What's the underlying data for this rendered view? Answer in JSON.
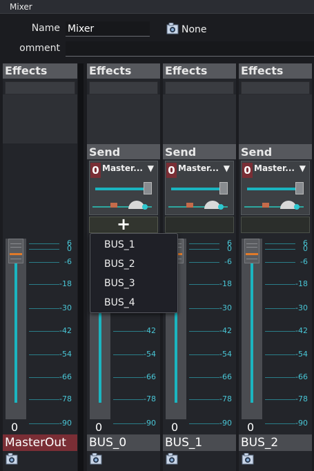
{
  "window": {
    "title": "Mixer"
  },
  "properties": {
    "name_label": "Name",
    "name_value": "Mixer",
    "comment_label": "omment",
    "comment_value": "",
    "preset_icon": "camera-icon",
    "preset_value": "None"
  },
  "strips": [
    {
      "effects_label": "Effects",
      "send_label": "",
      "name": "MasterOut",
      "volume": "0",
      "is_master": true
    },
    {
      "effects_label": "Effects",
      "send_label": "Send",
      "send_value": "0",
      "send_target": "Master...",
      "dropdown_arrow": "▼",
      "name": "BUS_0",
      "volume": "0"
    },
    {
      "effects_label": "Effects",
      "send_label": "Send",
      "send_value": "0",
      "send_target": "Master...",
      "dropdown_arrow": "▼",
      "name": "BUS_1",
      "volume": "0"
    },
    {
      "effects_label": "Effects",
      "send_label": "Send",
      "send_value": "0",
      "send_target": "Master...",
      "dropdown_arrow": "▼",
      "name": "BUS_2",
      "volume": "0"
    }
  ],
  "add_send_label": "+",
  "scale": [
    "6",
    "0",
    "-6",
    "-18",
    "-30",
    "-42",
    "-54",
    "-66",
    "-78",
    "-90"
  ],
  "popup": {
    "items": [
      "BUS_1",
      "BUS_2",
      "BUS_3",
      "BUS_4"
    ]
  },
  "colors": {
    "accent": "#1bb5c0",
    "master": "#7a2e35",
    "fader_grip": "#e07a2a"
  }
}
